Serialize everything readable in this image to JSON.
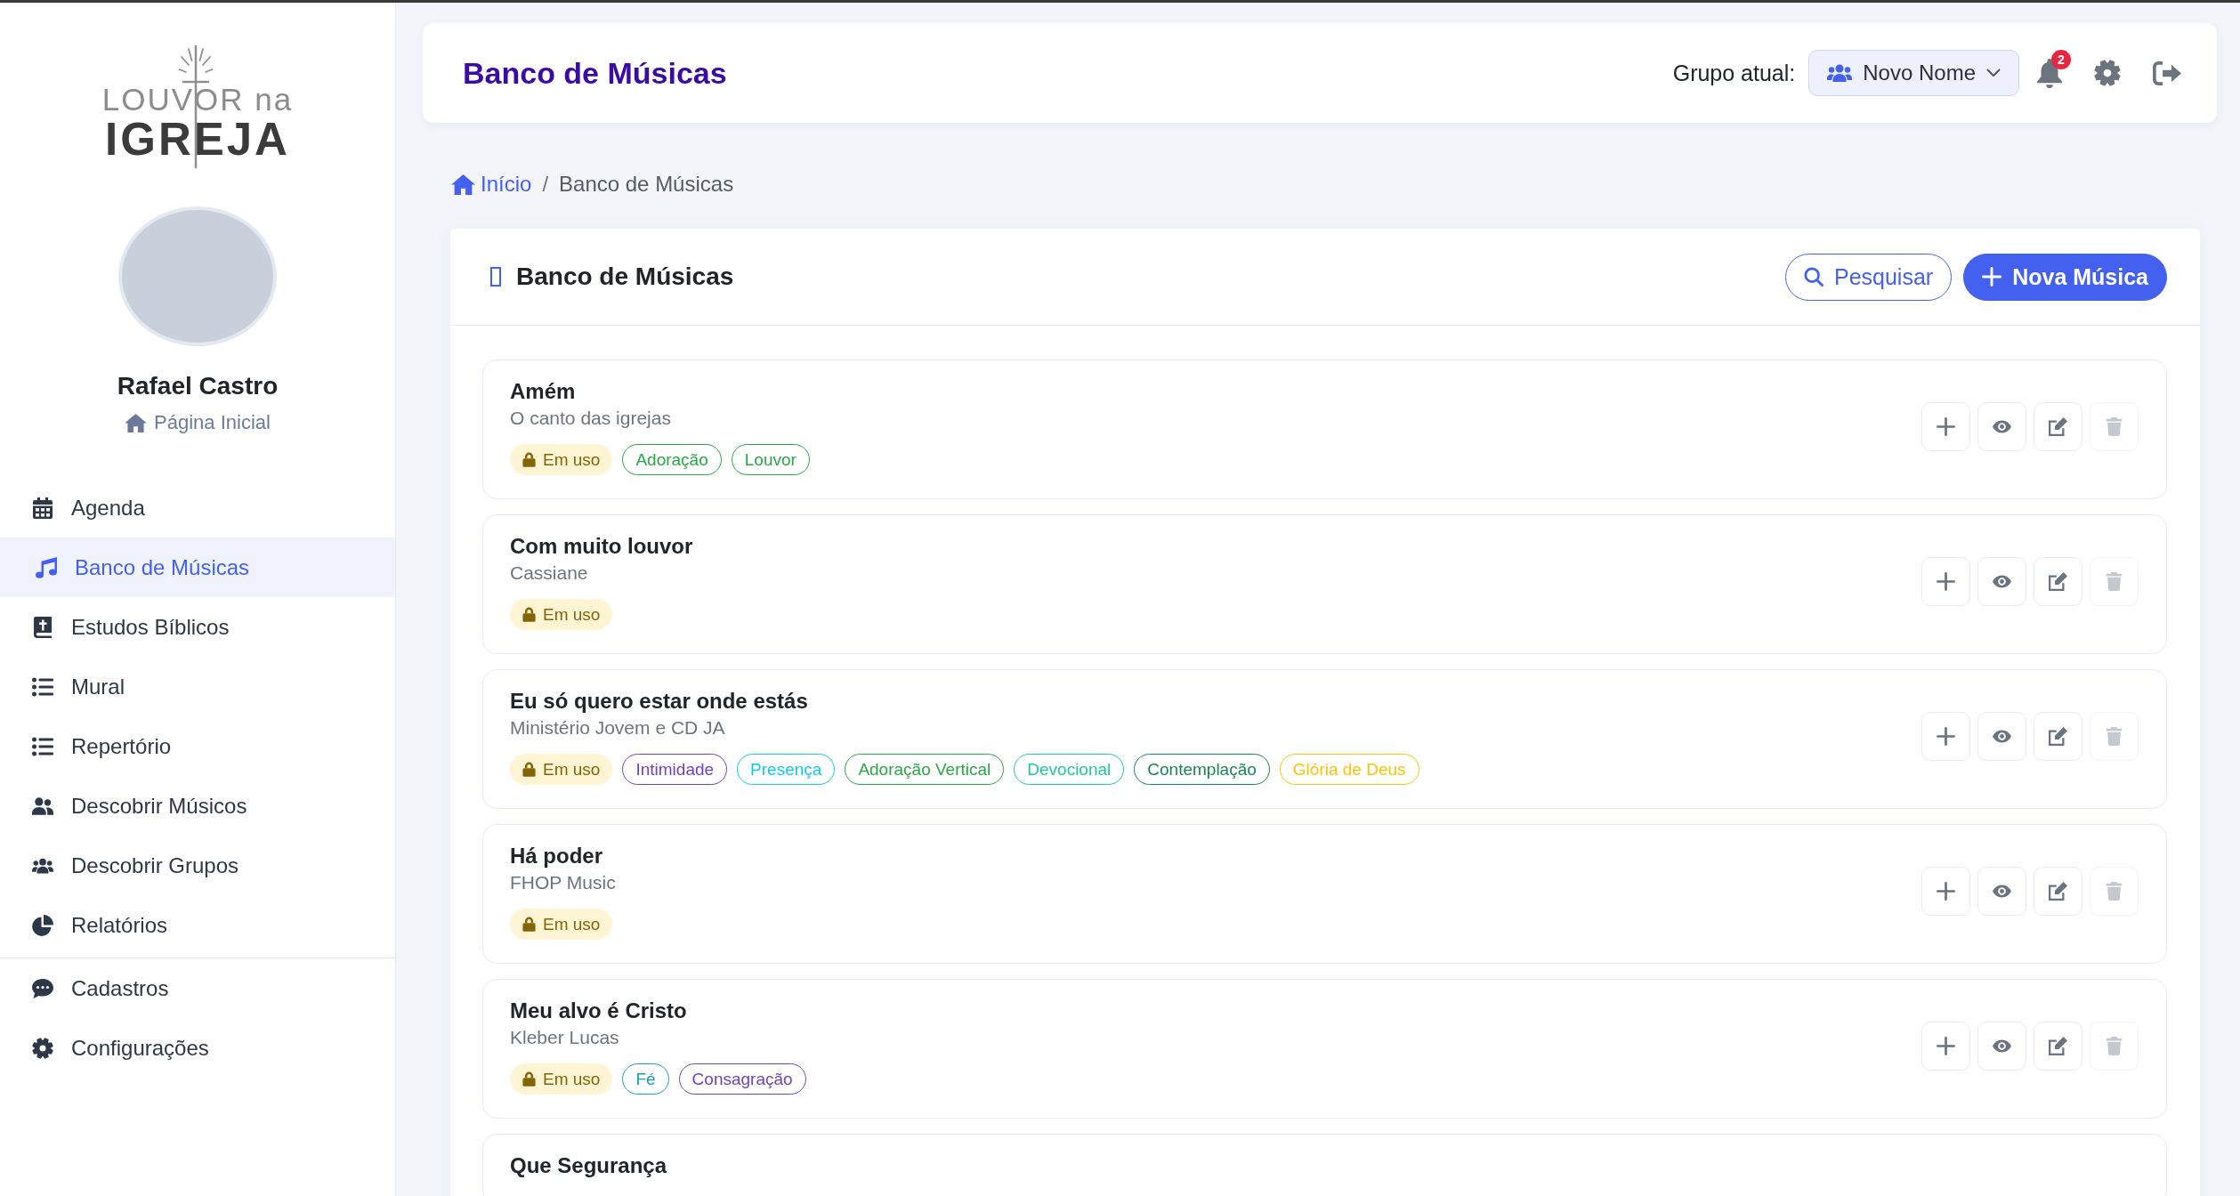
{
  "sidebar": {
    "logo": {
      "line_1": "LOUVOR na",
      "line_2": "IGREJA"
    },
    "user": {
      "name": "Rafael Castro",
      "home_link": "Página Inicial"
    },
    "sections": [
      {
        "items": [
          {
            "label": "Agenda",
            "selected": false
          },
          {
            "label": "Banco de Músicas",
            "selected": true
          },
          {
            "label": "Estudos Bíblicos",
            "selected": false
          },
          {
            "label": "Mural",
            "selected": false
          },
          {
            "label": "Repertório",
            "selected": false
          },
          {
            "label": "Descobrir Músicos",
            "selected": false
          },
          {
            "label": "Descobrir Grupos",
            "selected": false
          },
          {
            "label": "Relatórios",
            "selected": false
          }
        ]
      },
      {
        "items": [
          {
            "label": "Cadastros",
            "selected": false
          },
          {
            "label": "Configurações",
            "selected": false
          }
        ]
      }
    ]
  },
  "header": {
    "title": "Banco de Músicas",
    "group_label": "Grupo atual:",
    "group": "Novo Nome",
    "notification_count": "2"
  },
  "breadcrumb": {
    "separator": "/",
    "items": [
      {
        "label": "Início",
        "kind": "link"
      },
      {
        "label": "Banco de Músicas",
        "kind": "current"
      }
    ]
  },
  "songs_panel": {
    "title": "Banco de Músicas",
    "buttons": [
      {
        "label": "Pesquisar",
        "kind": "search"
      },
      {
        "label": "Nova Música",
        "kind": "add"
      }
    ],
    "songs": [
      {
        "title": "Amém",
        "artist": "O canto das igrejas",
        "status": "Em uso",
        "tags": [
          {
            "label": "Adoração",
            "color": "#28a745"
          },
          {
            "label": "Louvor",
            "color": "#28a745"
          }
        ],
        "actions": [
          {
            "kind": "add",
            "disabled": false
          },
          {
            "kind": "view",
            "disabled": false
          },
          {
            "kind": "edit",
            "disabled": false
          },
          {
            "kind": "delete",
            "disabled": true
          }
        ]
      },
      {
        "title": "Com muito louvor",
        "artist": "Cassiane",
        "status": "Em uso",
        "actions": [
          {
            "kind": "add",
            "disabled": false
          },
          {
            "kind": "view",
            "disabled": false
          },
          {
            "kind": "edit",
            "disabled": false
          },
          {
            "kind": "delete",
            "disabled": true
          }
        ]
      },
      {
        "title": "Eu só quero estar onde estás",
        "artist": "Ministério Jovem e CD JA",
        "status": "Em uso",
        "tags": [
          {
            "label": "Intimidade",
            "color": "#6f42c1"
          },
          {
            "label": "Presença",
            "color": "#0dcaf0"
          },
          {
            "label": "Adoração Vertical",
            "color": "#28a745"
          },
          {
            "label": "Devocional",
            "color": "#20c997"
          },
          {
            "label": "Contemplação",
            "color": "#198754"
          },
          {
            "label": "Glória de Deus",
            "color": "#ffc107"
          }
        ],
        "actions": [
          {
            "kind": "add",
            "disabled": false
          },
          {
            "kind": "view",
            "disabled": false
          },
          {
            "kind": "edit",
            "disabled": false
          },
          {
            "kind": "delete",
            "disabled": true
          }
        ]
      },
      {
        "title": "Há poder",
        "artist": "FHOP Music",
        "status": "Em uso",
        "actions": [
          {
            "kind": "add",
            "disabled": false
          },
          {
            "kind": "view",
            "disabled": false
          },
          {
            "kind": "edit",
            "disabled": false
          },
          {
            "kind": "delete",
            "disabled": true
          }
        ]
      },
      {
        "title": "Meu alvo é Cristo",
        "artist": "Kleber Lucas",
        "status": "Em uso",
        "tags": [
          {
            "label": "Fé",
            "color": "#17a2b8"
          },
          {
            "label": "Consagração",
            "color": "#6f42c1"
          }
        ],
        "actions": [
          {
            "kind": "add",
            "disabled": false
          },
          {
            "kind": "view",
            "disabled": false
          },
          {
            "kind": "edit",
            "disabled": false
          },
          {
            "kind": "delete",
            "disabled": true
          }
        ]
      },
      {
        "title": "Que Segurança"
      }
    ]
  }
}
